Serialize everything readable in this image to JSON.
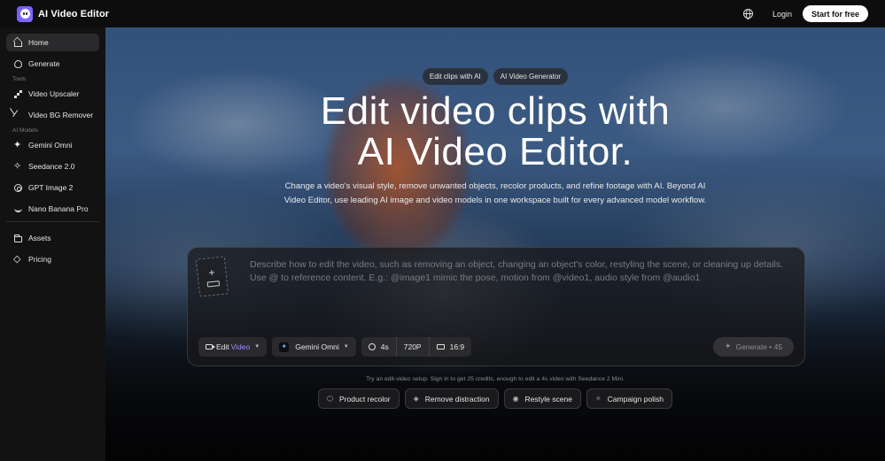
{
  "header": {
    "app_title": "AI Video Editor",
    "login_label": "Login",
    "cta_label": "Start for free"
  },
  "sidebar": {
    "items_top": [
      {
        "label": "Home",
        "icon": "home-icon",
        "active": true
      },
      {
        "label": "Generate",
        "icon": "generate-icon"
      }
    ],
    "tools_label": "Tools",
    "tools": [
      {
        "label": "Video Upscaler",
        "icon": "upscale-icon"
      },
      {
        "label": "Video BG Remover",
        "icon": "scissors-icon"
      }
    ],
    "models_label": "AI Models",
    "models": [
      {
        "label": "Gemini Omni",
        "icon": "sparkle-icon"
      },
      {
        "label": "Seedance 2.0",
        "icon": "seedance-icon"
      },
      {
        "label": "GPT Image 2",
        "icon": "openai-icon"
      },
      {
        "label": "Nano Banana Pro",
        "icon": "banana-icon"
      }
    ],
    "bottom": [
      {
        "label": "Assets",
        "icon": "folder-icon"
      },
      {
        "label": "Pricing",
        "icon": "diamond-icon"
      }
    ]
  },
  "hero": {
    "chips": [
      "Edit clips with AI",
      "AI Video Generator"
    ],
    "headline_line1": "Edit video clips with",
    "headline_line2": "AI Video Editor.",
    "subtitle": "Change a video's visual style, remove unwanted objects, recolor products, and refine footage with AI. Beyond AI Video Editor, use leading AI image and video models in one workspace built for every advanced model workflow."
  },
  "prompt": {
    "placeholder": "Describe how to edit the video, such as removing an object, changing an object's color, restyling the scene, or cleaning up details. Use @ to reference content. E.g.: @image1 mimic the pose, motion from @video1, audio style from @audio1",
    "mode_prefix": "Edit",
    "mode_accent": "Video",
    "model": "Gemini Omni",
    "duration": "4s",
    "resolution": "720P",
    "aspect": "16:9",
    "generate_label": "Generate • 45"
  },
  "hint": "Try an edit-video setup. Sign in to get 25 credits, enough to edit a 4s video with Seedance 2 Mini.",
  "presets": [
    {
      "label": "Product recolor",
      "icon": "cube-icon"
    },
    {
      "label": "Remove distraction",
      "icon": "eraser-icon"
    },
    {
      "label": "Restyle scene",
      "icon": "palette-icon"
    },
    {
      "label": "Campaign polish",
      "icon": "wand-icon"
    }
  ],
  "colors": {
    "accent": "#9a8cff",
    "logo": "#6d5cff",
    "background": "#0b0b0c"
  }
}
